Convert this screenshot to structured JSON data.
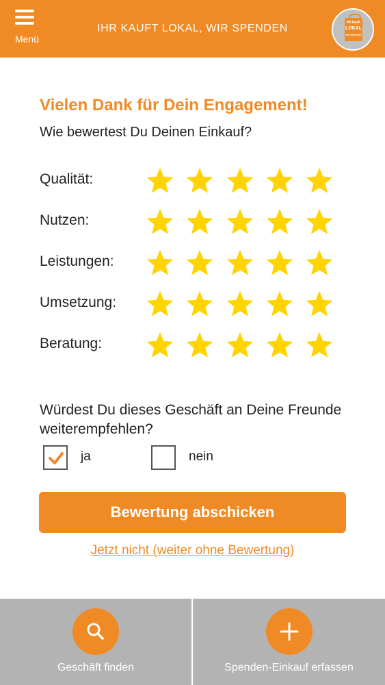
{
  "header": {
    "menu_label": "Menü",
    "title": "IHR KAUFT LOKAL, WIR SPENDEN",
    "logo_text": [
      "Ihr kauft",
      "LOKAL",
      "wir spenden"
    ]
  },
  "colors": {
    "accent": "#f08a24",
    "star": "#ffd400",
    "bottom_bar": "#b3b3b3"
  },
  "headline": "Vielen Dank für Dein Engagement!",
  "subhead": "Wie bewertest Du Deinen Einkauf?",
  "ratings": [
    {
      "label": "Qualität:",
      "stars": 5,
      "max": 5
    },
    {
      "label": "Nutzen:",
      "stars": 5,
      "max": 5
    },
    {
      "label": "Leistungen:",
      "stars": 5,
      "max": 5
    },
    {
      "label": "Umsetzung:",
      "stars": 5,
      "max": 5
    },
    {
      "label": "Beratung:",
      "stars": 5,
      "max": 5
    }
  ],
  "recommend": {
    "question": "Würdest Du dieses Geschäft an Deine Freunde weiterempfehlen?",
    "options": [
      {
        "label": "ja",
        "checked": true
      },
      {
        "label": "nein",
        "checked": false
      }
    ]
  },
  "submit_label": "Bewertung abschicken",
  "skip_label": "Jetzt nicht (weiter ohne Bewertung)",
  "bottom_nav": [
    {
      "label": "Geschäft finden",
      "icon": "search-icon"
    },
    {
      "label": "Spenden-Einkauf erfassen",
      "icon": "plus-icon"
    }
  ]
}
